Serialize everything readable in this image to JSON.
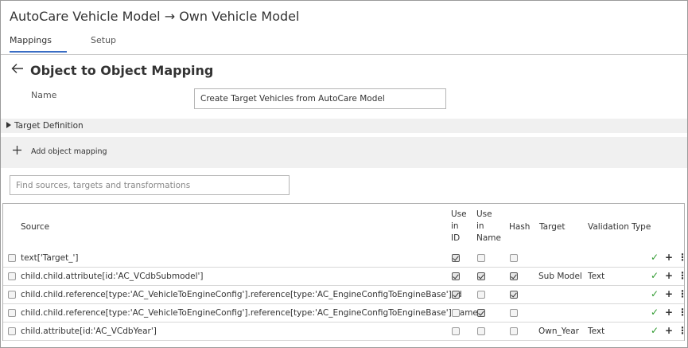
{
  "window": {
    "title": "AutoCare Vehicle Model → Own Vehicle Model"
  },
  "tabs": [
    {
      "label": "Mappings",
      "active": true
    },
    {
      "label": "Setup",
      "active": false
    }
  ],
  "page": {
    "title": "Object to Object Mapping"
  },
  "form": {
    "name_label": "Name",
    "name_value": "Create Target Vehicles from AutoCare Model"
  },
  "target_definition": {
    "label": "Target Definition",
    "expanded": false
  },
  "add_mapping": {
    "label": "Add object mapping"
  },
  "filter": {
    "placeholder": "Find sources, targets and transformations",
    "value": ""
  },
  "table": {
    "headers": {
      "source": "Source",
      "use_in_id": "Use\nin\nID",
      "use_in_name": "Use\nin\nName",
      "hash": "Hash",
      "target": "Target",
      "validation_type": "Validation Type"
    },
    "rows": [
      {
        "source": "text['Target_']",
        "use_in_id": true,
        "use_in_name": false,
        "hash": false,
        "target": "",
        "validation_type": ""
      },
      {
        "source": "child.child.attribute[id:'AC_VCdbSubmodel']",
        "use_in_id": true,
        "use_in_name": true,
        "hash": true,
        "target": "Sub Model",
        "validation_type": "Text"
      },
      {
        "source": "child.child.reference[type:'AC_VehicleToEngineConfig'].reference[type:'AC_EngineConfigToEngineBase'].id",
        "use_in_id": true,
        "use_in_name": false,
        "hash": true,
        "target": "",
        "validation_type": ""
      },
      {
        "source": "child.child.reference[type:'AC_VehicleToEngineConfig'].reference[type:'AC_EngineConfigToEngineBase'].name",
        "use_in_id": false,
        "use_in_name": true,
        "hash": false,
        "target": "",
        "validation_type": ""
      },
      {
        "source": "child.attribute[id:'AC_VCdbYear']",
        "use_in_id": false,
        "use_in_name": false,
        "hash": false,
        "target": "Own_Year",
        "validation_type": "Text"
      }
    ],
    "row_actions": {
      "confirm_icon": "check-icon",
      "add_icon": "plus-icon",
      "more_icon": "vertical-ellipsis-icon"
    }
  },
  "colors": {
    "accent": "#3a6dc4",
    "confirm": "#2e9a2e",
    "panel_bg": "#f0f0f0"
  }
}
